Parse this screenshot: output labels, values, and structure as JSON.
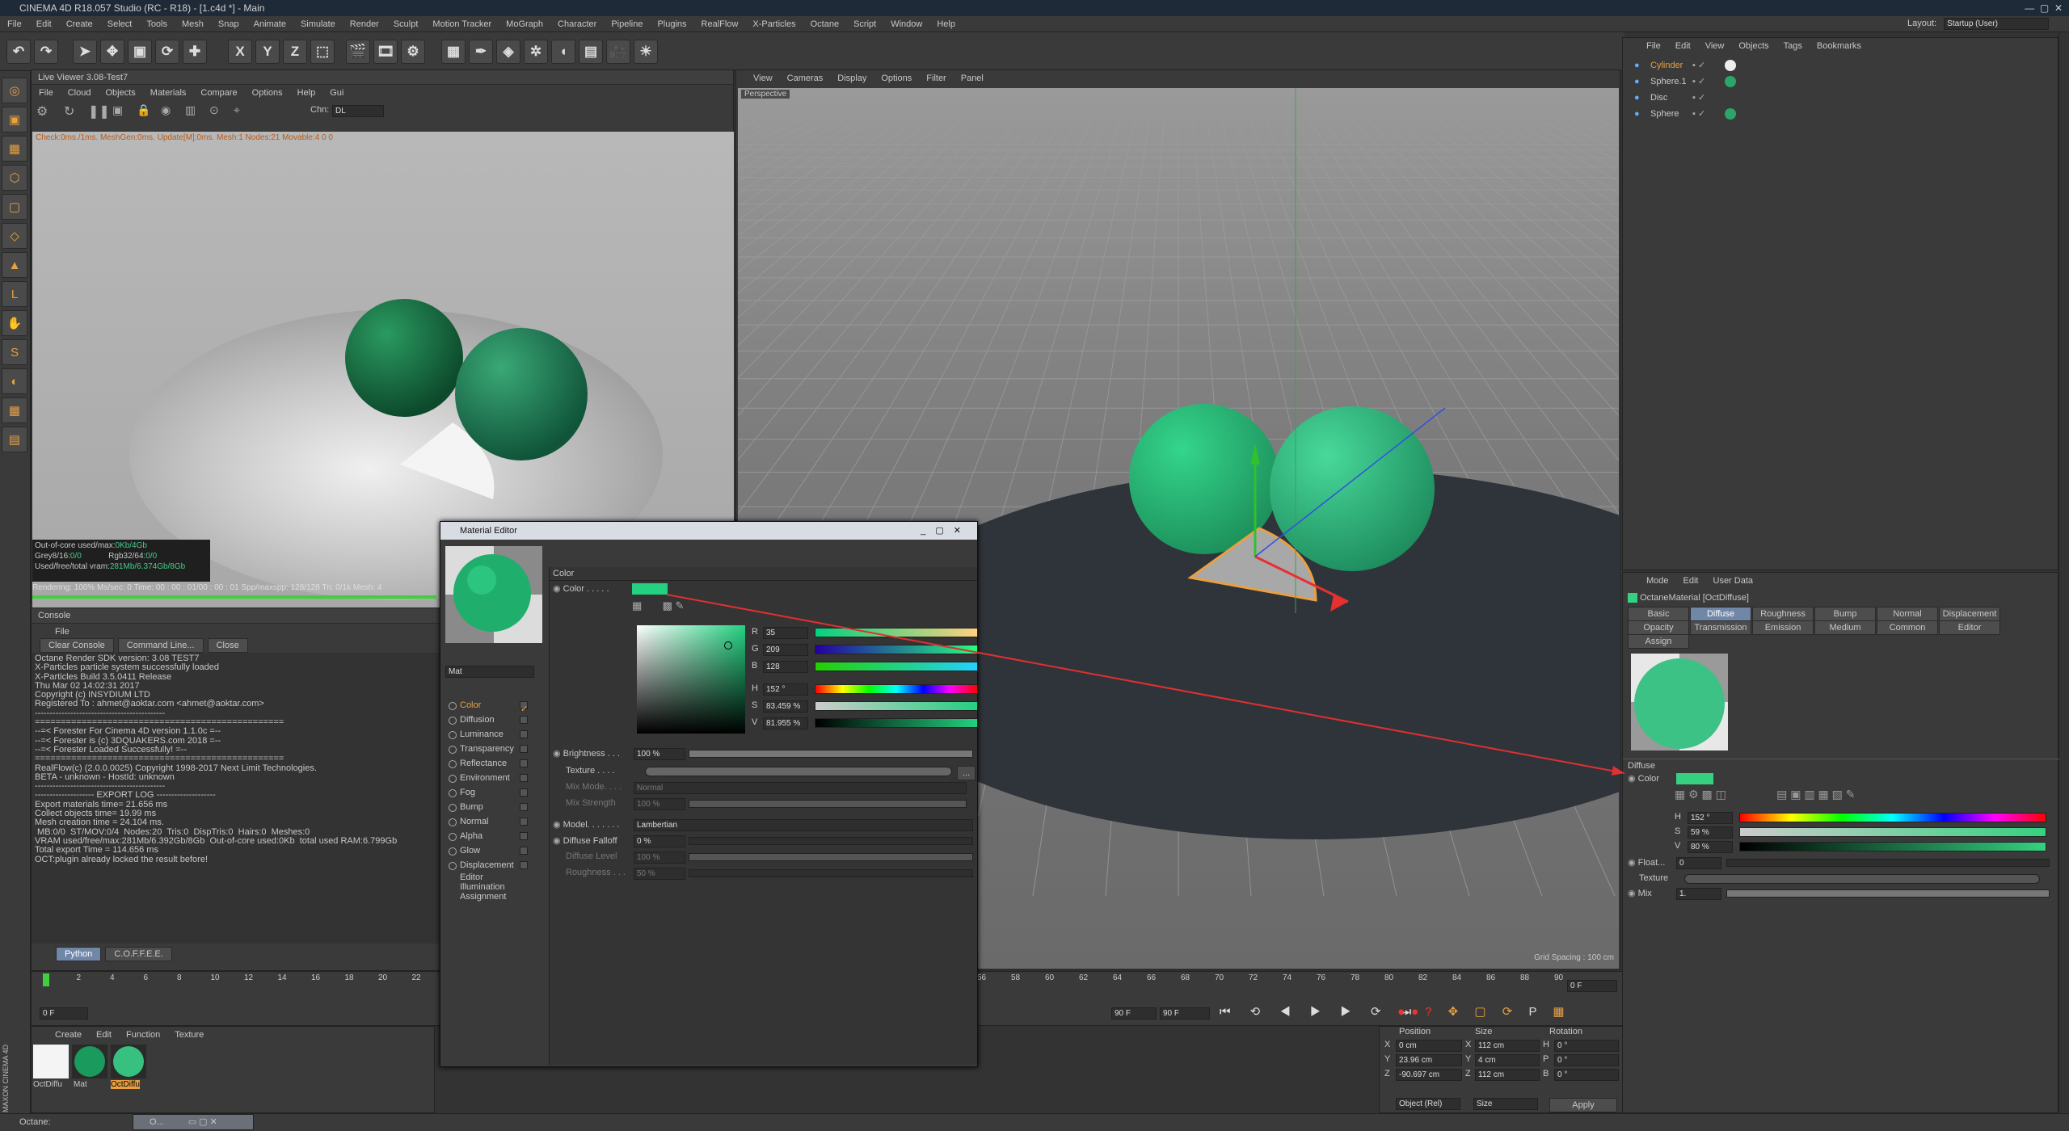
{
  "window": {
    "title": "CINEMA 4D R18.057 Studio (RC - R18) - [1.c4d *] - Main"
  },
  "main_menu": [
    "File",
    "Edit",
    "Create",
    "Select",
    "Tools",
    "Mesh",
    "Snap",
    "Animate",
    "Simulate",
    "Render",
    "Sculpt",
    "Motion Tracker",
    "MoGraph",
    "Character",
    "Pipeline",
    "Plugins",
    "RealFlow",
    "X-Particles",
    "Octane",
    "Script",
    "Window",
    "Help"
  ],
  "layout": {
    "label": "Layout:",
    "value": "Startup (User)"
  },
  "live_viewer": {
    "title": "Live Viewer 3.08-Test7",
    "menu": [
      "File",
      "Cloud",
      "Objects",
      "Materials",
      "Compare",
      "Options",
      "Help",
      "Gui"
    ],
    "chn_label": "Chn:",
    "chn_value": "DL",
    "status_line": "Check:0ms./1ms. MeshGen:0ms. Update[M]:0ms. Mesh:1 Nodes:21 Movable:4  0 0",
    "stats": {
      "ooc_label": "Out-of-core used/max:",
      "ooc_value": "0Kb/4Gb",
      "grey_label": "Grey8/16:",
      "grey_value": "0/0",
      "rgb_label": "Rgb32/64:",
      "rgb_value": "0/0",
      "vram_label": "Used/free/total vram:",
      "vram_value": "281Mb/6.374Gb/8Gb"
    },
    "render_line": "Rendering: 100% Ms/sec: 0    Time: 00 : 00 : 01/00 : 00 : 01  Spp/maxspp: 128/128    Tri: 0/1k  Mesh: 4"
  },
  "viewport": {
    "menu": [
      "View",
      "Cameras",
      "Display",
      "Options",
      "Filter",
      "Panel"
    ],
    "label": "Perspective",
    "grid_spacing": "Grid Spacing : 100 cm"
  },
  "object_manager": {
    "menu": [
      "File",
      "Edit",
      "View",
      "Objects",
      "Tags",
      "Bookmarks"
    ],
    "objects": [
      "Cylinder",
      "Sphere.1",
      "Disc",
      "Sphere"
    ]
  },
  "attributes": {
    "menu": [
      "Mode",
      "Edit",
      "User Data"
    ],
    "title": "OctaneMaterial [OctDiffuse]",
    "tabs_row1": [
      "Basic",
      "Diffuse",
      "Roughness",
      "Bump",
      "Normal",
      "Displacement"
    ],
    "tabs_row2": [
      "Opacity",
      "Transmission",
      "Emission",
      "Medium",
      "Common",
      "Editor"
    ],
    "tabs_row3": [
      "Assign"
    ],
    "active_tab": "Diffuse",
    "section": "Diffuse",
    "color_label": "Color",
    "h_label": "H",
    "h_value": "152 °",
    "s_label": "S",
    "s_value": "59 %",
    "v_label": "V",
    "v_value": "80 %",
    "float_label": "Float...",
    "float_value": "0",
    "texture_label": "Texture",
    "mix_label": "Mix",
    "mix_value": "1.",
    "color_hex": "#35d180"
  },
  "console": {
    "title": "Console",
    "menu": [
      "File"
    ],
    "buttons": [
      "Clear Console",
      "Command Line...",
      "Close"
    ],
    "lines": [
      "Octane Render SDK version: 3.08 TEST7",
      "",
      "X-Particles particle system successfully loaded",
      "X-Particles Build 3.5.0411 Release",
      "Thu Mar 02 14:02:31 2017",
      "Copyright (c) INSYDIUM LTD",
      "Registered To : ahmet@aoktar.com <ahmet@aoktar.com>",
      "--------------------------------------------",
      "",
      "================================================",
      "--=< Forester For Cinema 4D version 1.1.0c =--",
      "--=< Forester is (c) 3DQUAKERS.com 2018 =--",
      "--=< Forester Loaded Successfully! =--",
      "================================================",
      "",
      "RealFlow(c) (2.0.0.0025) Copyright 1998-2017 Next Limit Technologies.",
      "BETA - unknown - HostId: unknown",
      "--------------------------------------------",
      "-------------------- EXPORT LOG --------------------",
      "Export materials time= 21.656 ms",
      "Collect objects time= 19.99 ms",
      "Mesh creation time = 24.104 ms.",
      " MB:0/0  ST/MOV:0/4  Nodes:20  Tris:0  DispTris:0  Hairs:0  Meshes:0",
      "VRAM used/free/max:281Mb/6.392Gb/8Gb  Out-of-core used:0Kb  total used RAM:6.799Gb",
      "Total export Time = 114.656 ms",
      "OCT:plugin already locked the result before!"
    ],
    "lang_tabs": [
      "Python",
      "C.O.F.F.E.E."
    ]
  },
  "timeline": {
    "ticks_left": [
      "0",
      "2",
      "4",
      "6",
      "8",
      "10",
      "12",
      "14",
      "16",
      "18",
      "20",
      "22"
    ],
    "ticks_right": [
      "56",
      "58",
      "60",
      "62",
      "64",
      "66",
      "68",
      "70",
      "72",
      "74",
      "76",
      "78",
      "80",
      "82",
      "84",
      "86",
      "88",
      "90"
    ],
    "current_frame": "0 F",
    "start_field": "0 F",
    "end_field": "90 F",
    "end_field2": "90 F",
    "right_frame": "0 F"
  },
  "material_manager": {
    "menu": [
      "Create",
      "Edit",
      "Function",
      "Texture"
    ],
    "materials": [
      "OctDiffu",
      "Mat",
      "OctDiffu"
    ]
  },
  "coordinates": {
    "headers": [
      "Position",
      "Size",
      "Rotation"
    ],
    "rows": [
      {
        "axis": "X",
        "pos": "0 cm",
        "saxis": "X",
        "size": "112 cm",
        "raxis": "H",
        "rot": "0 °"
      },
      {
        "axis": "Y",
        "pos": "23.96 cm",
        "saxis": "Y",
        "size": "4 cm",
        "raxis": "P",
        "rot": "0 °"
      },
      {
        "axis": "Z",
        "pos": "-90.697 cm",
        "saxis": "Z",
        "size": "112 cm",
        "raxis": "B",
        "rot": "0 °"
      }
    ],
    "mode": "Object (Rel)",
    "size_mode": "Size",
    "apply": "Apply"
  },
  "material_editor": {
    "title": "Material Editor",
    "section": "Color",
    "color_label": "Color . . . . .",
    "name": "Mat",
    "channels": [
      "Color",
      "Diffusion",
      "Luminance",
      "Transparency",
      "Reflectance",
      "Environment",
      "Fog",
      "Bump",
      "Normal",
      "Alpha",
      "Glow",
      "Displacement",
      "Editor",
      "Illumination",
      "Assignment"
    ],
    "rgb": [
      {
        "label": "R",
        "value": "35"
      },
      {
        "label": "G",
        "value": "209"
      },
      {
        "label": "B",
        "value": "128"
      }
    ],
    "hsv": [
      {
        "label": "H",
        "value": "152 °"
      },
      {
        "label": "S",
        "value": "83.459 %"
      },
      {
        "label": "V",
        "value": "81.955 %"
      }
    ],
    "brightness_label": "Brightness . . .",
    "brightness_value": "100 %",
    "texture_label": "Texture . . . .",
    "mix_mode_label": "Mix Mode. . . .",
    "mix_mode_value": "Normal",
    "mix_strength_label": "Mix Strength",
    "mix_strength_value": "100 %",
    "model_label": "Model. . . . . . .",
    "model_value": "Lambertian",
    "diffuse_falloff_label": "Diffuse Falloff",
    "diffuse_falloff_value": "0 %",
    "diffuse_level_label": "Diffuse Level",
    "diffuse_level_value": "100 %",
    "roughness_label": "Roughness . . .",
    "roughness_value": "50 %",
    "color_hex": "#23d180"
  },
  "statusbar": {
    "text": "Octane:",
    "mini_window": "O..."
  },
  "side_labels": [
    "MAXON",
    "CINEMA 4D"
  ]
}
